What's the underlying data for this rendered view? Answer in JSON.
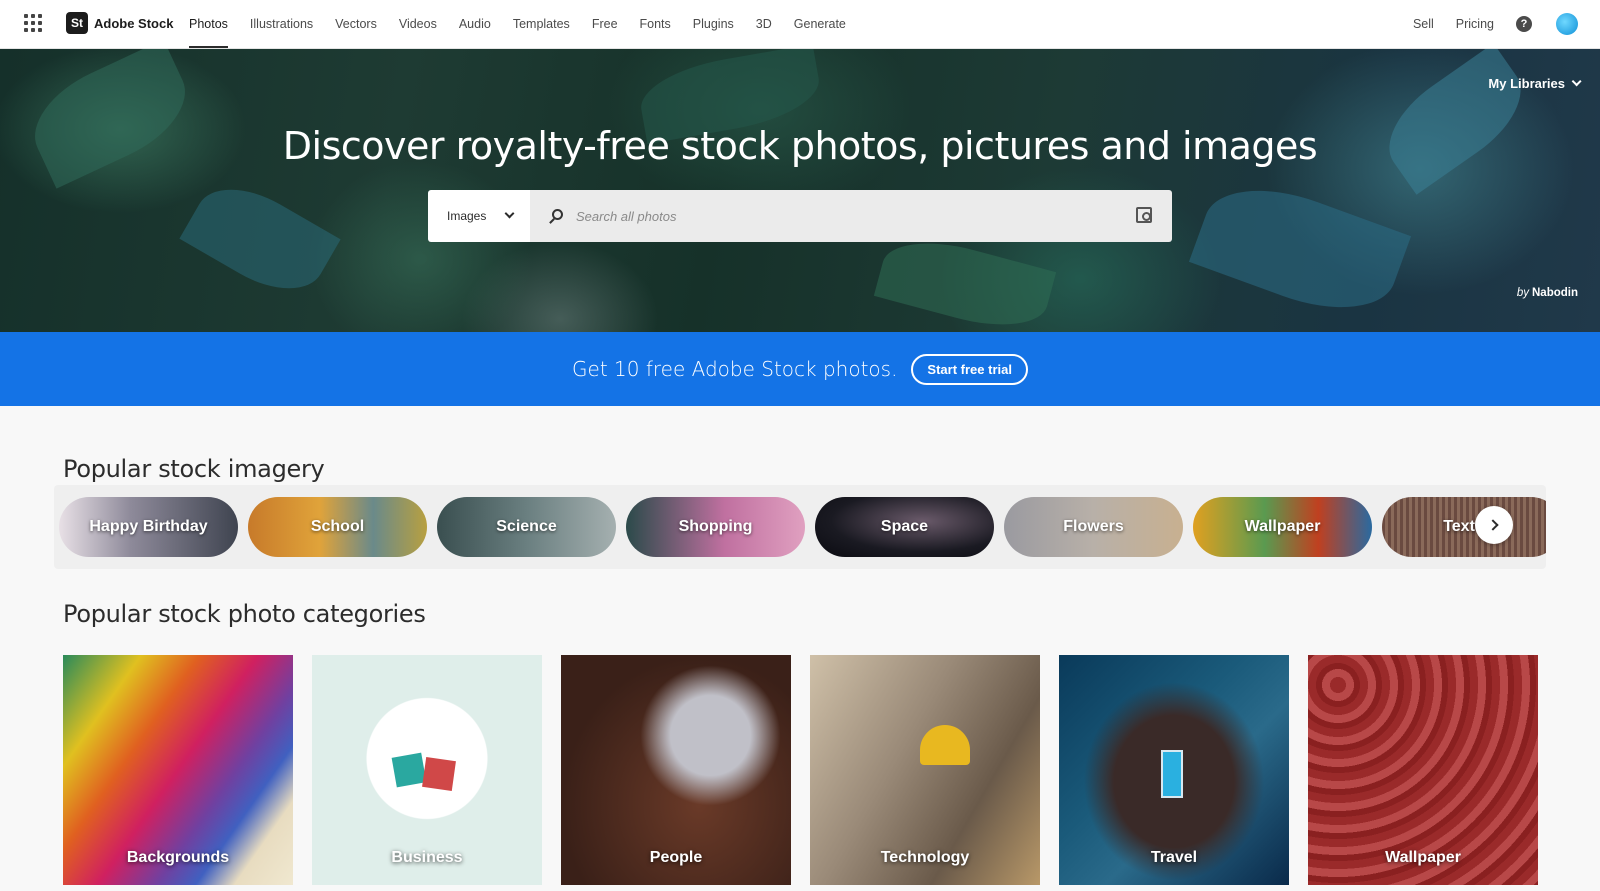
{
  "nav": {
    "brand_logo": "St",
    "brand_name": "Adobe Stock",
    "links": [
      "Photos",
      "Illustrations",
      "Vectors",
      "Videos",
      "Audio",
      "Templates",
      "Free",
      "Fonts",
      "Plugins",
      "3D",
      "Generate"
    ],
    "active_link": "Photos",
    "right_links": [
      "Sell",
      "Pricing"
    ],
    "help_glyph": "?"
  },
  "hero": {
    "title": "Discover royalty-free stock photos, pictures and images",
    "my_libraries": "My Libraries",
    "credit_by": "by",
    "credit_author": "Nabodin"
  },
  "search": {
    "type_selected": "Images",
    "placeholder": "Search all photos",
    "value": ""
  },
  "promo": {
    "text": "Get 10 free Adobe Stock photos.",
    "button": "Start free trial",
    "color": "#1473e6"
  },
  "popular_imagery": {
    "title": "Popular stock imagery",
    "items": [
      "Happy Birthday",
      "School",
      "Science",
      "Shopping",
      "Space",
      "Flowers",
      "Wallpaper",
      "Texture"
    ]
  },
  "categories": {
    "title": "Popular stock photo categories",
    "items": [
      "Backgrounds",
      "Business",
      "People",
      "Technology",
      "Travel",
      "Wallpaper"
    ]
  },
  "icons": [
    "apps-grid-icon",
    "help-icon",
    "avatar",
    "chevron-down-icon",
    "search-icon",
    "visual-search-icon",
    "chevron-right-icon"
  ]
}
